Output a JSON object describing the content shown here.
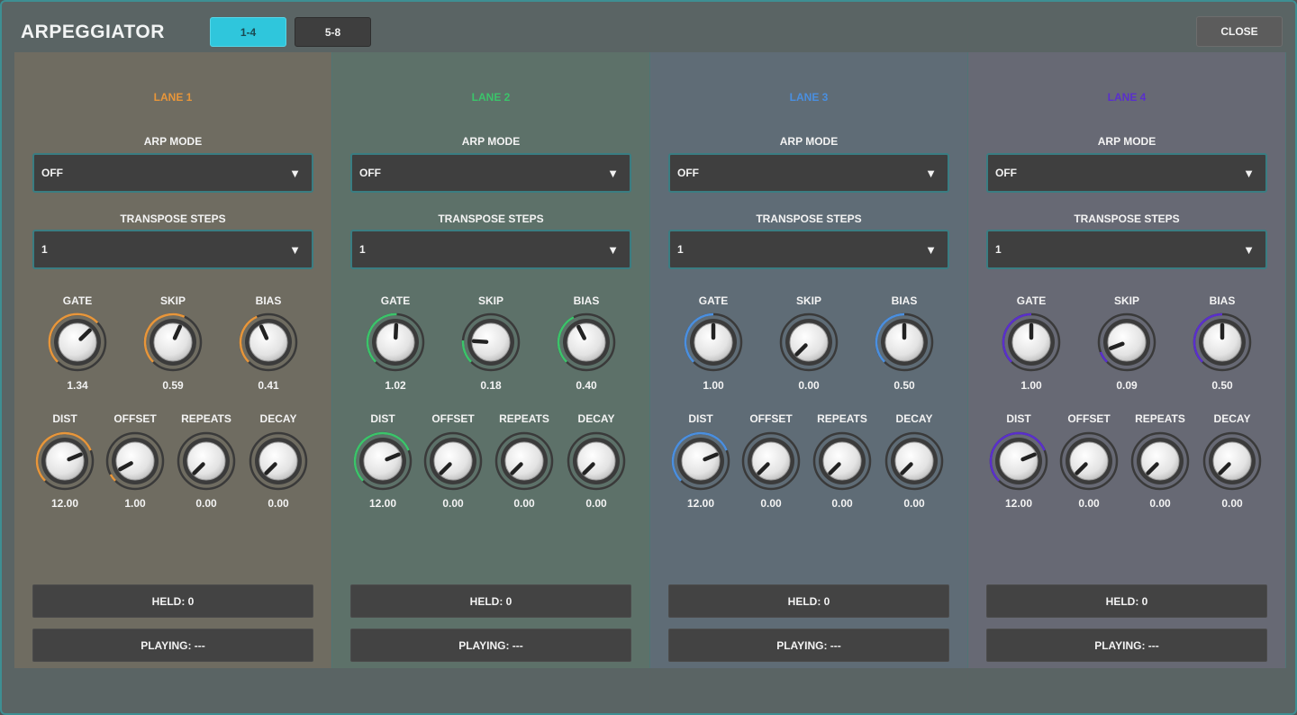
{
  "header": {
    "title": "ARPEGGIATOR",
    "close_label": "CLOSE"
  },
  "page_tabs": [
    {
      "label": "1-4",
      "active": true
    },
    {
      "label": "5-8",
      "active": false
    }
  ],
  "colors": {
    "lane1": "#e8963a",
    "lane2": "#3bc46a",
    "lane3": "#4a8fe0",
    "lane4": "#5a2fcc",
    "active_tab": "#2fc6dc"
  },
  "lanes": [
    {
      "title": "LANE 1",
      "color": "#e8963a",
      "arp_mode_label": "ARP MODE",
      "arp_mode_value": "OFF",
      "transpose_label": "TRANSPOSE STEPS",
      "transpose_value": "1",
      "knobs_row1": [
        {
          "label": "GATE",
          "value": "1.34",
          "fraction": 0.67
        },
        {
          "label": "SKIP",
          "value": "0.59",
          "fraction": 0.59
        },
        {
          "label": "BIAS",
          "value": "0.41",
          "fraction": 0.41
        }
      ],
      "knobs_row2": [
        {
          "label": "DIST",
          "value": "12.00",
          "fraction": 0.75
        },
        {
          "label": "OFFSET",
          "value": "1.00",
          "fraction": 0.06
        },
        {
          "label": "REPEATS",
          "value": "0.00",
          "fraction": 0.0
        },
        {
          "label": "DECAY",
          "value": "0.00",
          "fraction": 0.0
        }
      ],
      "held": "HELD: 0",
      "playing": "PLAYING: ---"
    },
    {
      "title": "LANE 2",
      "color": "#3bc46a",
      "arp_mode_label": "ARP MODE",
      "arp_mode_value": "OFF",
      "transpose_label": "TRANSPOSE STEPS",
      "transpose_value": "1",
      "knobs_row1": [
        {
          "label": "GATE",
          "value": "1.02",
          "fraction": 0.51
        },
        {
          "label": "SKIP",
          "value": "0.18",
          "fraction": 0.18
        },
        {
          "label": "BIAS",
          "value": "0.40",
          "fraction": 0.4
        }
      ],
      "knobs_row2": [
        {
          "label": "DIST",
          "value": "12.00",
          "fraction": 0.75
        },
        {
          "label": "OFFSET",
          "value": "0.00",
          "fraction": 0.0
        },
        {
          "label": "REPEATS",
          "value": "0.00",
          "fraction": 0.0
        },
        {
          "label": "DECAY",
          "value": "0.00",
          "fraction": 0.0
        }
      ],
      "held": "HELD: 0",
      "playing": "PLAYING: ---"
    },
    {
      "title": "LANE 3",
      "color": "#4a8fe0",
      "arp_mode_label": "ARP MODE",
      "arp_mode_value": "OFF",
      "transpose_label": "TRANSPOSE STEPS",
      "transpose_value": "1",
      "knobs_row1": [
        {
          "label": "GATE",
          "value": "1.00",
          "fraction": 0.5
        },
        {
          "label": "SKIP",
          "value": "0.00",
          "fraction": 0.0
        },
        {
          "label": "BIAS",
          "value": "0.50",
          "fraction": 0.5
        }
      ],
      "knobs_row2": [
        {
          "label": "DIST",
          "value": "12.00",
          "fraction": 0.75
        },
        {
          "label": "OFFSET",
          "value": "0.00",
          "fraction": 0.0
        },
        {
          "label": "REPEATS",
          "value": "0.00",
          "fraction": 0.0
        },
        {
          "label": "DECAY",
          "value": "0.00",
          "fraction": 0.0
        }
      ],
      "held": "HELD: 0",
      "playing": "PLAYING: ---"
    },
    {
      "title": "LANE 4",
      "color": "#5a2fcc",
      "arp_mode_label": "ARP MODE",
      "arp_mode_value": "OFF",
      "transpose_label": "TRANSPOSE STEPS",
      "transpose_value": "1",
      "knobs_row1": [
        {
          "label": "GATE",
          "value": "1.00",
          "fraction": 0.5
        },
        {
          "label": "SKIP",
          "value": "0.09",
          "fraction": 0.09
        },
        {
          "label": "BIAS",
          "value": "0.50",
          "fraction": 0.5
        }
      ],
      "knobs_row2": [
        {
          "label": "DIST",
          "value": "12.00",
          "fraction": 0.75
        },
        {
          "label": "OFFSET",
          "value": "0.00",
          "fraction": 0.0
        },
        {
          "label": "REPEATS",
          "value": "0.00",
          "fraction": 0.0
        },
        {
          "label": "DECAY",
          "value": "0.00",
          "fraction": 0.0
        }
      ],
      "held": "HELD: 0",
      "playing": "PLAYING: ---"
    }
  ]
}
